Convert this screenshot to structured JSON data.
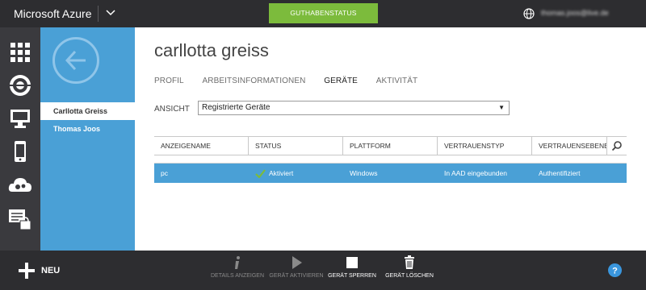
{
  "topbar": {
    "brand": "Microsoft Azure",
    "credit_status_button": "GUTHABENSTATUS",
    "user_email": "thomas.joos@live.de"
  },
  "iconbar": {
    "items": [
      "all-items-icon",
      "web-apps-icon",
      "virtual-machines-icon",
      "mobile-services-icon",
      "cloud-services-icon",
      "active-directory-icon"
    ]
  },
  "sidebar": {
    "items": [
      {
        "label": "Carllotta Greiss",
        "active": true
      },
      {
        "label": "Thomas Joos",
        "active": false
      }
    ]
  },
  "main": {
    "title": "carllotta greiss",
    "tabs": [
      {
        "label": "PROFIL",
        "active": false
      },
      {
        "label": "ARBEITSINFORMATIONEN",
        "active": false
      },
      {
        "label": "GERÄTE",
        "active": true
      },
      {
        "label": "AKTIVITÄT",
        "active": false
      }
    ],
    "filter": {
      "label": "ANSICHT",
      "selected": "Registrierte Geräte"
    },
    "table": {
      "columns": [
        "ANZEIGENAME",
        "STATUS",
        "PLATTFORM",
        "VERTRAUENSTYP",
        "VERTRAUENSEBENE"
      ],
      "rows": [
        {
          "name": "pc",
          "status": "Aktiviert",
          "platform": "Windows",
          "trust_type": "In AAD eingebunden",
          "trust_level": "Authentifiziert",
          "selected": true
        }
      ]
    }
  },
  "bottombar": {
    "new_label": "NEU",
    "commands": [
      {
        "label": "DETAILS ANZEIGEN",
        "icon": "info-icon",
        "enabled": false
      },
      {
        "label": "GERÄT AKTIVIEREN",
        "icon": "play-icon",
        "enabled": false
      },
      {
        "label": "GERÄT SPERREN",
        "icon": "stop-icon",
        "enabled": true
      },
      {
        "label": "GERÄT LÖSCHEN",
        "icon": "trash-icon",
        "enabled": true
      }
    ]
  },
  "colors": {
    "accent_blue": "#4aa0d6",
    "credit_green": "#7cbb3c",
    "chrome_dark": "#2d2d30",
    "check_green": "#7cbb3c"
  }
}
